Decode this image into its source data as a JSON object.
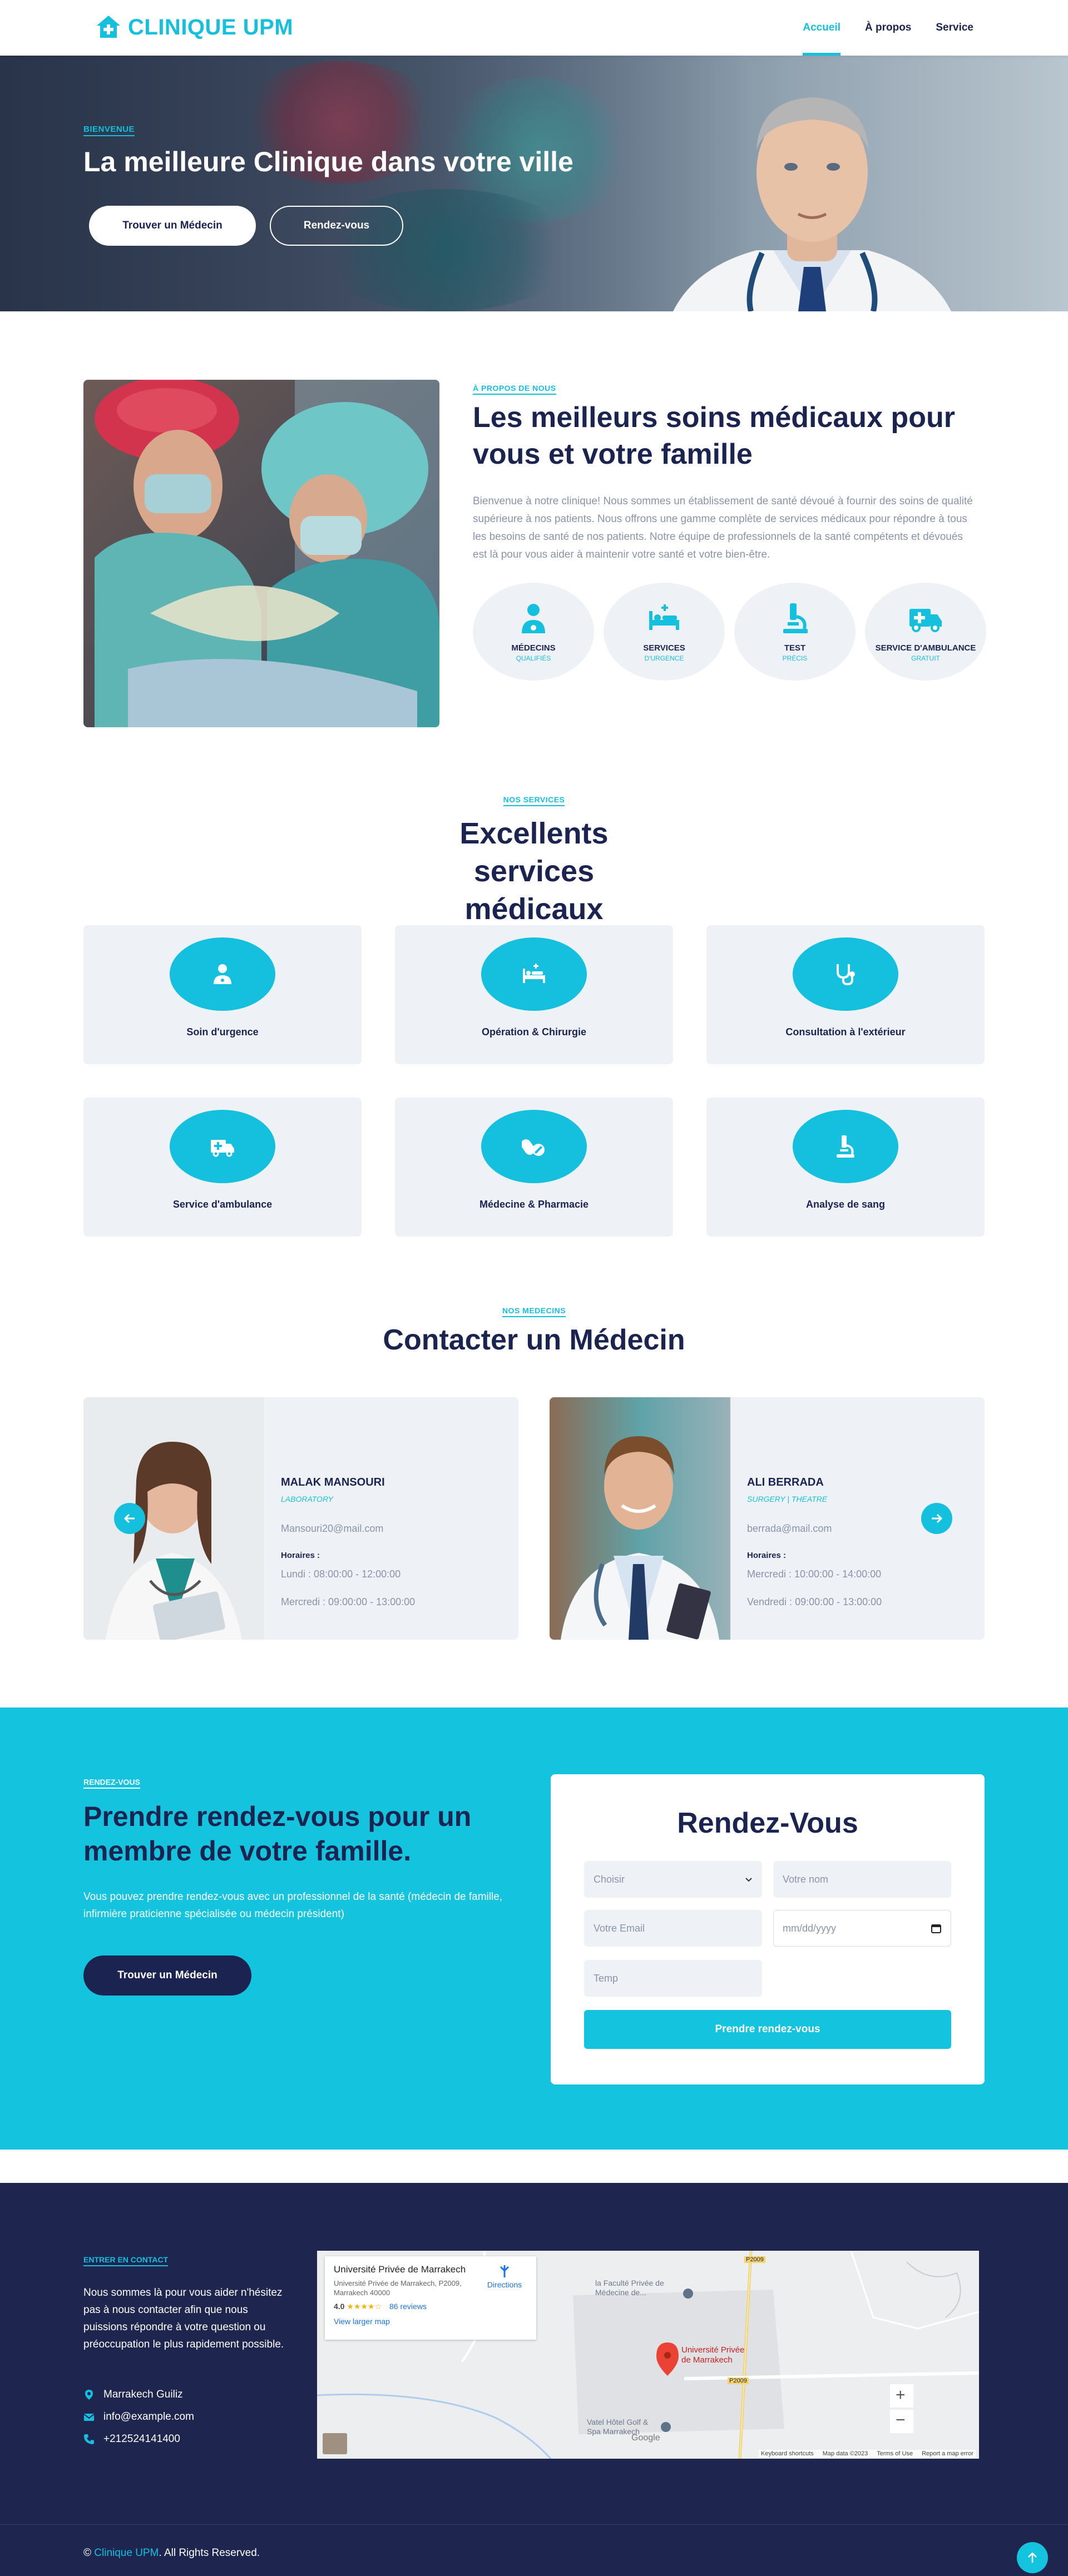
{
  "brand": {
    "name": "CLINIQUE UPM",
    "accent": "#14c0de",
    "navy": "#1b2450"
  },
  "nav": {
    "items": [
      "Accueil",
      "À propos",
      "Service"
    ],
    "active": "Accueil"
  },
  "hero": {
    "tag": "BIENVENUE",
    "title": "La meilleure Clinique dans votre ville",
    "btn_doctor": "Trouver un Médecin",
    "btn_appointment": "Rendez-vous"
  },
  "about": {
    "tag": "À PROPOS DE NOUS",
    "title": "Les meilleurs soins médicaux pour vous et votre famille",
    "text": "Bienvenue à notre clinique! Nous sommes un établissement de santé dévoué à fournir des soins de qualité supérieure à nos patients. Nous offrons une gamme complète de services médicaux pour répondre à tous les besoins de santé de nos patients. Notre équipe de professionnels de la santé compétents et dévoués est là pour vous aider à maintenir votre santé et votre bien-être.",
    "features": [
      {
        "title": "MÉDECINS",
        "sub": "QUALIFIÉS",
        "icon": "doctor-icon"
      },
      {
        "title": "SERVICES",
        "sub": "D'URGENCE",
        "icon": "hospital-bed-icon"
      },
      {
        "title": "TEST",
        "sub": "PRÉCIS",
        "icon": "microscope-icon"
      },
      {
        "title": "SERVICE D'AMBULANCE",
        "sub": "GRATUIT",
        "icon": "ambulance-icon"
      }
    ]
  },
  "services": {
    "tag": "NOS SERVICES",
    "title": "Excellents services médicaux",
    "items": [
      {
        "label": "Soin d'urgence",
        "icon": "medical-staff-icon"
      },
      {
        "label": "Opération & Chirurgie",
        "icon": "hospital-bed-icon"
      },
      {
        "label": "Consultation à l'extérieur",
        "icon": "stethoscope-icon"
      },
      {
        "label": "Service d'ambulance",
        "icon": "ambulance-icon"
      },
      {
        "label": "Médecine & Pharmacie",
        "icon": "pills-icon"
      },
      {
        "label": "Analyse de sang",
        "icon": "microscope-icon"
      }
    ]
  },
  "doctors": {
    "tag": "NOS MEDECINS",
    "title": "Contacter un Médecin",
    "items": [
      {
        "name": "MALAK MANSOURI",
        "role": "LABORATORY",
        "email": "Mansouri20@mail.com",
        "hours_label": "Horaires :",
        "hours_1": "Lundi : 08:00:00 - 12:00:00",
        "hours_2": "Mercredi : 09:00:00 - 13:00:00"
      },
      {
        "name": "ALI BERRADA",
        "role": "SURGERY | THEATRE",
        "email": "berrada@mail.com",
        "hours_label": "Horaires :",
        "hours_1": "Mercredi : 10:00:00 - 14:00:00",
        "hours_2": "Vendredi : 09:00:00 - 13:00:00"
      }
    ]
  },
  "appointment": {
    "tag": "RENDEZ-VOUS",
    "title": "Prendre rendez-vous pour un membre de votre famille.",
    "text": "Vous pouvez prendre rendez-vous avec un professionnel de la santé (médecin de famille, infirmière praticienne spécialisée ou médecin président)",
    "btn": "Trouver un Médecin",
    "form": {
      "title": "Rendez-Vous",
      "select_value": "Choisir",
      "name_placeholder": "Votre nom",
      "email_placeholder": "Votre Email",
      "date_placeholder": "mm/dd/yyyy",
      "time_placeholder": "Temp",
      "submit": "Prendre rendez-vous"
    }
  },
  "footer": {
    "tag": "ENTRER EN CONTACT",
    "text": "Nous sommes là pour vous aider n'hésitez pas à nous contacter afin que nous puissions répondre à votre question ou préoccupation le plus rapidement possible.",
    "address": "Marrakech Guiliz",
    "email": "info@example.com",
    "phone": "+212524141400",
    "copyright_prefix": "©",
    "copyright_brand": "Clinique UPM",
    "copyright_suffix": ". All Rights Reserved.",
    "map": {
      "place": "Université Privée de Marrakech",
      "address": "Université Privée de Marrakech, P2009, Marrakech 40000",
      "rating": "4.0",
      "stars": "★★★★☆",
      "reviews": "86 reviews",
      "directions": "Directions",
      "larger": "View larger map",
      "pin_label": "Université Privée de Marrakech",
      "label_fac": "la Faculté Privée de Médecine de...",
      "label_hotel": "Vatel Hôtel Golf & Spa Marrakech",
      "road_1": "P2009",
      "road_2": "P2009",
      "google": "Google",
      "attrib": [
        "Keyboard shortcuts",
        "Map data ©2023",
        "Terms of Use",
        "Report a map error"
      ]
    }
  }
}
